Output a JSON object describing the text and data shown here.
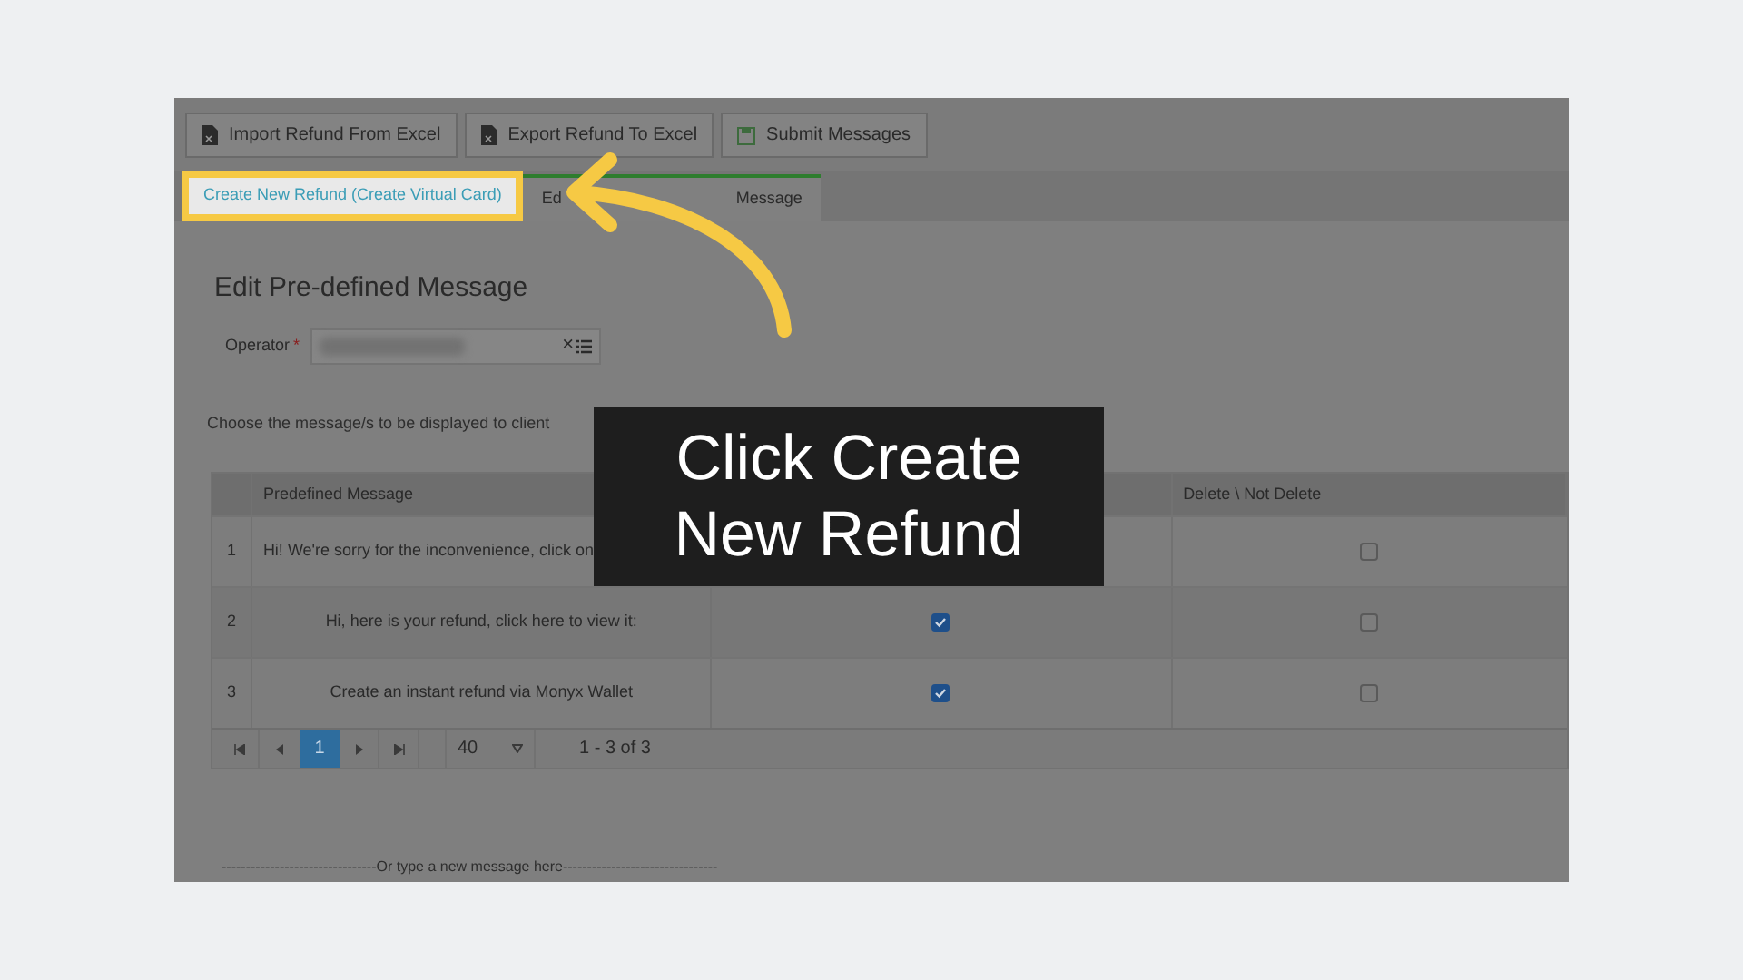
{
  "toolbar": [
    {
      "label": "Import Refund From Excel",
      "kind": "file"
    },
    {
      "label": "Export Refund To Excel",
      "kind": "file"
    },
    {
      "label": "Submit Messages",
      "kind": "save"
    }
  ],
  "tabs": [
    {
      "label": "Create New Refund (Create Virtual Card)",
      "selected": false,
      "highlighted": true
    },
    {
      "label_parts": [
        "Ed",
        "Message"
      ],
      "selected": true,
      "highlighted": false
    }
  ],
  "heading": "Edit Pre-defined Message",
  "operator": {
    "label": "Operator",
    "required_mark": "*",
    "clear": "×"
  },
  "instruction": "Choose the message/s to be displayed to client",
  "table": {
    "columns": [
      "Predefined Message",
      "Delete \\ Not Delete"
    ],
    "rows": [
      {
        "number": "1",
        "message": "Hi! We're sorry for the inconvenience, click on",
        "delete": false
      },
      {
        "number": "2",
        "message": "Hi, here is your refund, click here to view it:",
        "active": true,
        "delete": false
      },
      {
        "number": "3",
        "message": "Create an instant refund via Monyx Wallet",
        "active": true,
        "delete": false
      }
    ]
  },
  "pager": {
    "pages": [
      {
        "label": "1",
        "selected": true
      }
    ],
    "page_size": "40",
    "summary": "1 - 3 of 3"
  },
  "new_message_divider": "--------------------------------Or type a new message here--------------------------------",
  "callout": {
    "lines": [
      "Click Create",
      "New Refund"
    ]
  }
}
